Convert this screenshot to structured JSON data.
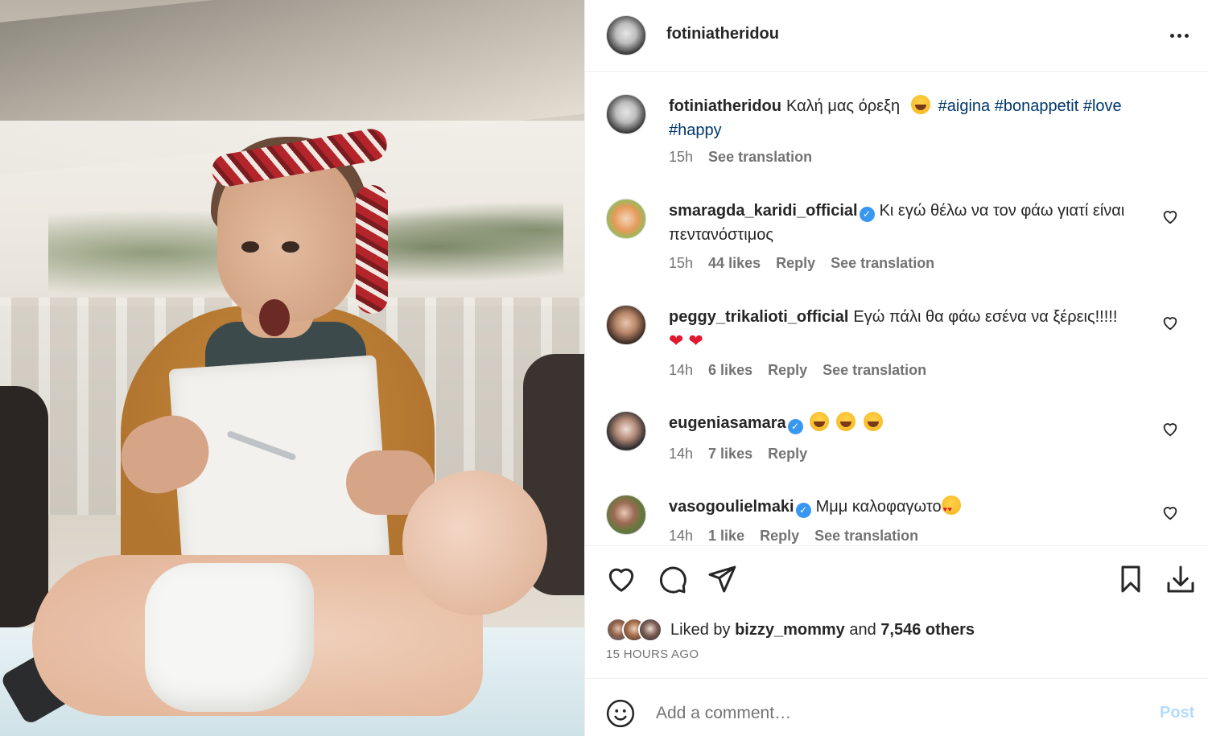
{
  "post": {
    "author": "fotiniatheridou",
    "caption_text": "Καλή μας όρεξη",
    "hashtags": [
      "#aigina",
      "#bonappetit",
      "#love",
      "#happy"
    ],
    "time": "15h",
    "see_translation": "See translation"
  },
  "comments": [
    {
      "username": "smaragda_karidi_official",
      "verified": true,
      "text": "Κι εγώ θέλω να τον φάω γιατί είναι πεντανόστιμος",
      "time": "15h",
      "likes": "44 likes",
      "reply": "Reply",
      "translation": "See translation"
    },
    {
      "username": "peggy_trikalioti_official",
      "verified": false,
      "text": "Εγώ πάλι θα φάω εσένα να ξέρεις!!!!!",
      "time": "14h",
      "likes": "6 likes",
      "reply": "Reply",
      "translation": "See translation"
    },
    {
      "username": "eugeniasamara",
      "verified": true,
      "text": "",
      "time": "14h",
      "likes": "7 likes",
      "reply": "Reply"
    },
    {
      "username": "vasogoulielmaki",
      "verified": true,
      "text": "Μμμ καλοφαγωτο",
      "time": "14h",
      "likes": "1 like",
      "reply": "Reply",
      "translation": "See translation"
    }
  ],
  "likes": {
    "prefix": "Liked by",
    "user": "bizzy_mommy",
    "and": "and",
    "others": "7,546 others"
  },
  "timestamp": "15 HOURS AGO",
  "composer": {
    "placeholder": "Add a comment…",
    "post_label": "Post"
  },
  "colors": {
    "hashtag": "#00376b",
    "verified": "#3897f0",
    "muted": "#737373",
    "post_disabled": "#b3dbff"
  }
}
